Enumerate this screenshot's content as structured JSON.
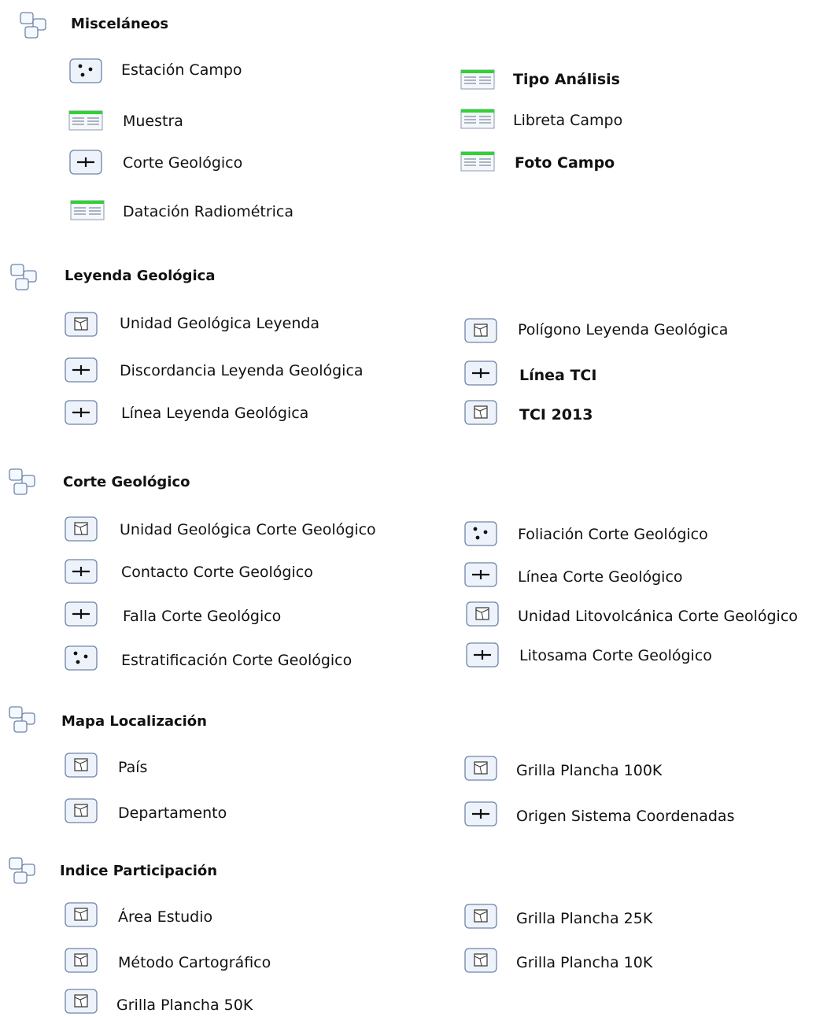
{
  "groups": [
    {
      "title": "Misceláneos",
      "items": [
        {
          "label": "Estación Campo",
          "icon": "point-feature-icon"
        },
        {
          "label": "Tipo Análisis",
          "icon": "table-icon"
        },
        {
          "label": "Muestra",
          "icon": "table-icon"
        },
        {
          "label": "Libreta Campo",
          "icon": "table-icon"
        },
        {
          "label": "Corte Geológico",
          "icon": "line-feature-icon"
        },
        {
          "label": "Foto Campo",
          "icon": "table-icon"
        },
        {
          "label": "Datación Radiométrica",
          "icon": "table-icon"
        }
      ]
    },
    {
      "title": "Leyenda Geológica",
      "items": [
        {
          "label": "Unidad Geológica Leyenda",
          "icon": "polygon-feature-icon"
        },
        {
          "label": "Polígono Leyenda Geológica",
          "icon": "polygon-feature-icon"
        },
        {
          "label": "Discordancia Leyenda Geológica",
          "icon": "line-feature-icon"
        },
        {
          "label": "Línea TCI",
          "icon": "line-feature-icon"
        },
        {
          "label": "Línea Leyenda Geológica",
          "icon": "line-feature-icon"
        },
        {
          "label": "TCI 2013",
          "icon": "polygon-feature-icon"
        }
      ]
    },
    {
      "title": "Corte Geológico",
      "items": [
        {
          "label": "Unidad Geológica Corte Geológico",
          "icon": "polygon-feature-icon"
        },
        {
          "label": "Foliación Corte Geológico",
          "icon": "point-feature-icon"
        },
        {
          "label": "Contacto Corte Geológico",
          "icon": "line-feature-icon"
        },
        {
          "label": "Línea Corte Geológico",
          "icon": "line-feature-icon"
        },
        {
          "label": "Falla Corte Geológico",
          "icon": "line-feature-icon"
        },
        {
          "label": "Unidad Litovolcánica Corte Geológico",
          "icon": "polygon-feature-icon"
        },
        {
          "label": "Estratificación Corte Geológico",
          "icon": "point-feature-icon"
        },
        {
          "label": "Litosama Corte Geológico",
          "icon": "line-feature-icon"
        }
      ]
    },
    {
      "title": "Mapa Localización",
      "items": [
        {
          "label": "País",
          "icon": "polygon-feature-icon"
        },
        {
          "label": "Grilla Plancha 100K",
          "icon": "polygon-feature-icon"
        },
        {
          "label": "Departamento",
          "icon": "polygon-feature-icon"
        },
        {
          "label": "Origen Sistema Coordenadas",
          "icon": "line-feature-icon"
        }
      ]
    },
    {
      "title": "Indice Participación",
      "items": [
        {
          "label": "Área Estudio",
          "icon": "polygon-feature-icon"
        },
        {
          "label": "Grilla Plancha 25K",
          "icon": "polygon-feature-icon"
        },
        {
          "label": "Método Cartográfico",
          "icon": "polygon-feature-icon"
        },
        {
          "label": "Grilla Plancha 10K",
          "icon": "polygon-feature-icon"
        },
        {
          "label": "Grilla Plancha 50K",
          "icon": "polygon-feature-icon"
        }
      ]
    }
  ],
  "colors": {
    "icon_border": "#6f84a6",
    "icon_bg": "#eef3fb",
    "table_header": "#32d232"
  }
}
